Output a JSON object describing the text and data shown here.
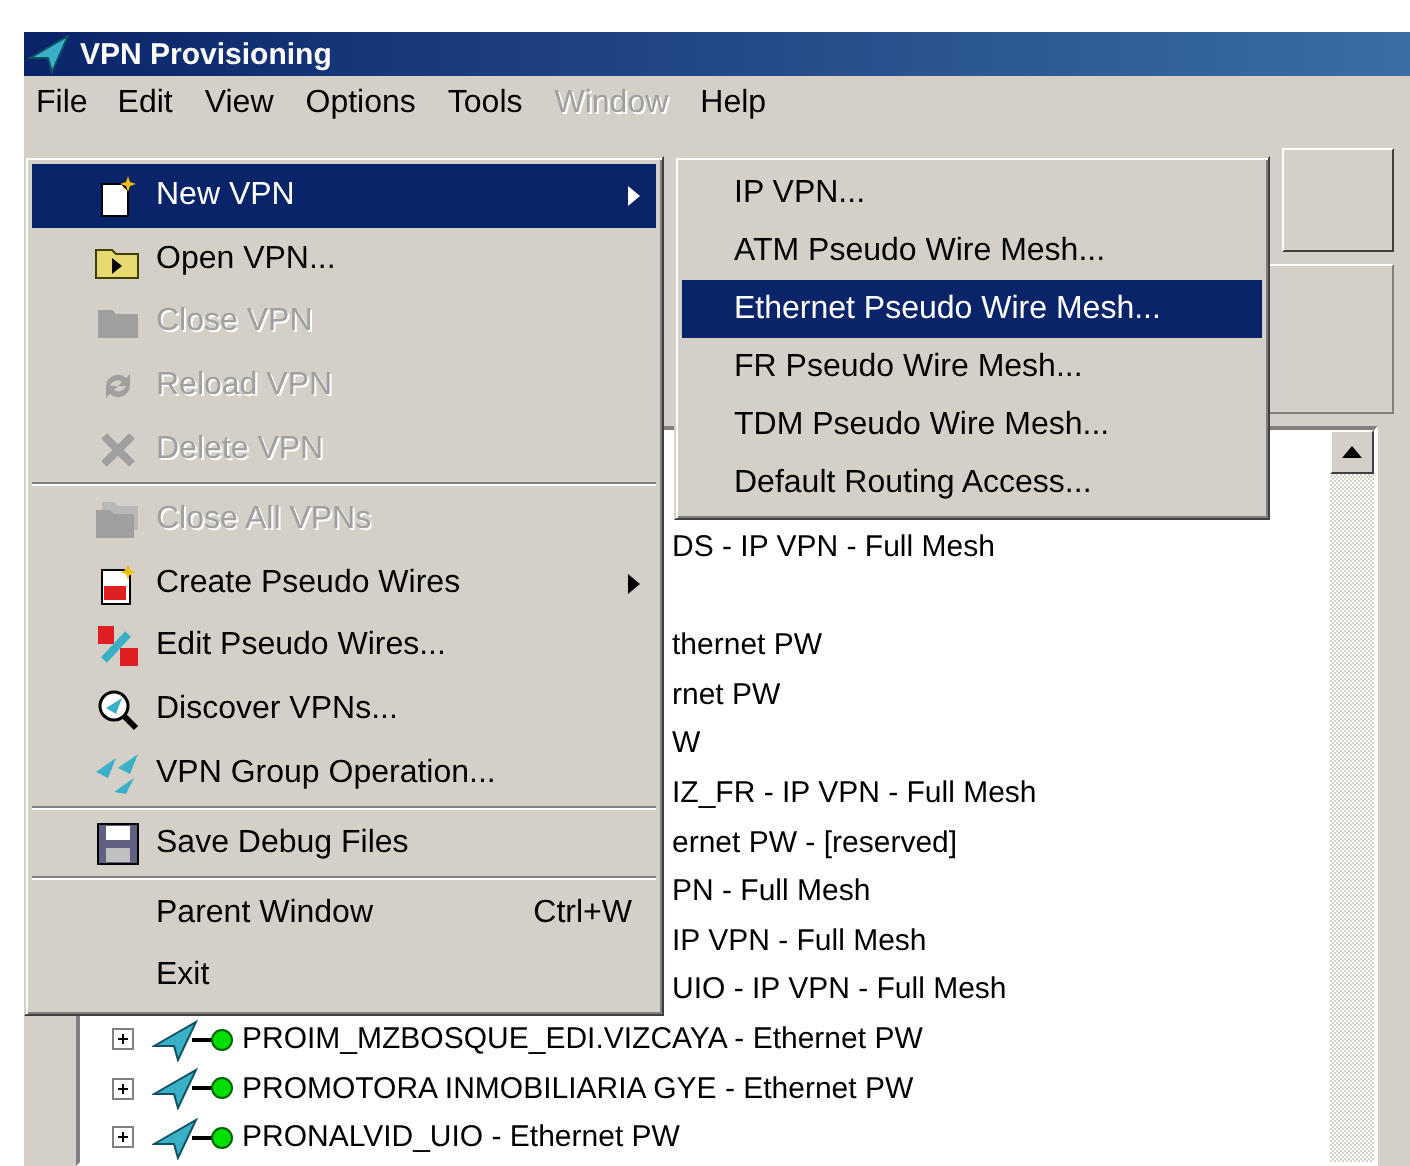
{
  "window": {
    "title": "VPN Provisioning"
  },
  "menubar": [
    {
      "label": "File",
      "selected": true,
      "disabled": false
    },
    {
      "label": "Edit",
      "selected": false,
      "disabled": false
    },
    {
      "label": "View",
      "selected": false,
      "disabled": false
    },
    {
      "label": "Options",
      "selected": false,
      "disabled": false
    },
    {
      "label": "Tools",
      "selected": false,
      "disabled": false
    },
    {
      "label": "Window",
      "selected": false,
      "disabled": true
    },
    {
      "label": "Help",
      "selected": false,
      "disabled": false
    }
  ],
  "file_menu": [
    {
      "kind": "item",
      "label": "New VPN",
      "selected": true,
      "disabled": false,
      "submenu": true
    },
    {
      "kind": "item",
      "label": "Open VPN...",
      "selected": false,
      "disabled": false,
      "submenu": false
    },
    {
      "kind": "item",
      "label": "Close VPN",
      "selected": false,
      "disabled": true,
      "submenu": false
    },
    {
      "kind": "item",
      "label": "Reload VPN",
      "selected": false,
      "disabled": true,
      "submenu": false
    },
    {
      "kind": "item",
      "label": "Delete VPN",
      "selected": false,
      "disabled": true,
      "submenu": false
    },
    {
      "kind": "separator"
    },
    {
      "kind": "item",
      "label": "Close All VPNs",
      "selected": false,
      "disabled": true,
      "submenu": false
    },
    {
      "kind": "item",
      "label": "Create Pseudo Wires",
      "selected": false,
      "disabled": false,
      "submenu": true
    },
    {
      "kind": "item",
      "label": "Edit Pseudo Wires...",
      "selected": false,
      "disabled": false,
      "submenu": false
    },
    {
      "kind": "item",
      "label": "Discover VPNs...",
      "selected": false,
      "disabled": false,
      "submenu": false
    },
    {
      "kind": "item",
      "label": "VPN Group Operation...",
      "selected": false,
      "disabled": false,
      "submenu": false
    },
    {
      "kind": "separator"
    },
    {
      "kind": "item",
      "label": "Save Debug Files",
      "selected": false,
      "disabled": false,
      "submenu": false
    },
    {
      "kind": "separator"
    },
    {
      "kind": "item",
      "label": "Parent Window",
      "shortcut": "Ctrl+W",
      "selected": false,
      "disabled": false,
      "submenu": false
    },
    {
      "kind": "item",
      "label": "Exit",
      "selected": false,
      "disabled": false,
      "submenu": false
    }
  ],
  "new_vpn_submenu": [
    {
      "label": "IP VPN...",
      "selected": false
    },
    {
      "label": "ATM Pseudo Wire Mesh...",
      "selected": false
    },
    {
      "label": "Ethernet Pseudo Wire Mesh...",
      "selected": true
    },
    {
      "label": "FR Pseudo Wire Mesh...",
      "selected": false
    },
    {
      "label": "TDM Pseudo Wire Mesh...",
      "selected": false
    },
    {
      "label": "Default Routing Access...",
      "selected": false
    }
  ],
  "tree": [
    {
      "kind": "partial",
      "text": "DS - IP VPN - Full Mesh"
    },
    {
      "kind": "blank"
    },
    {
      "kind": "partial",
      "text": "thernet PW"
    },
    {
      "kind": "partial",
      "text": "rnet PW"
    },
    {
      "kind": "partial",
      "text": "W"
    },
    {
      "kind": "partial",
      "text": "IZ_FR - IP VPN - Full Mesh"
    },
    {
      "kind": "partial",
      "text": "ernet PW - [reserved]"
    },
    {
      "kind": "partial",
      "text": "PN - Full Mesh"
    },
    {
      "kind": "partial",
      "text": "IP VPN - Full Mesh"
    },
    {
      "kind": "partial",
      "text": "UIO - IP VPN - Full Mesh"
    },
    {
      "kind": "full",
      "text": "PROIM_MZBOSQUE_EDI.VIZCAYA - Ethernet PW",
      "expanded": false
    },
    {
      "kind": "full",
      "text": "PROMOTORA INMOBILIARIA GYE - Ethernet PW",
      "expanded": false
    },
    {
      "kind": "full",
      "text": "PRONALVID_UIO - Ethernet PW",
      "expanded": false
    }
  ]
}
